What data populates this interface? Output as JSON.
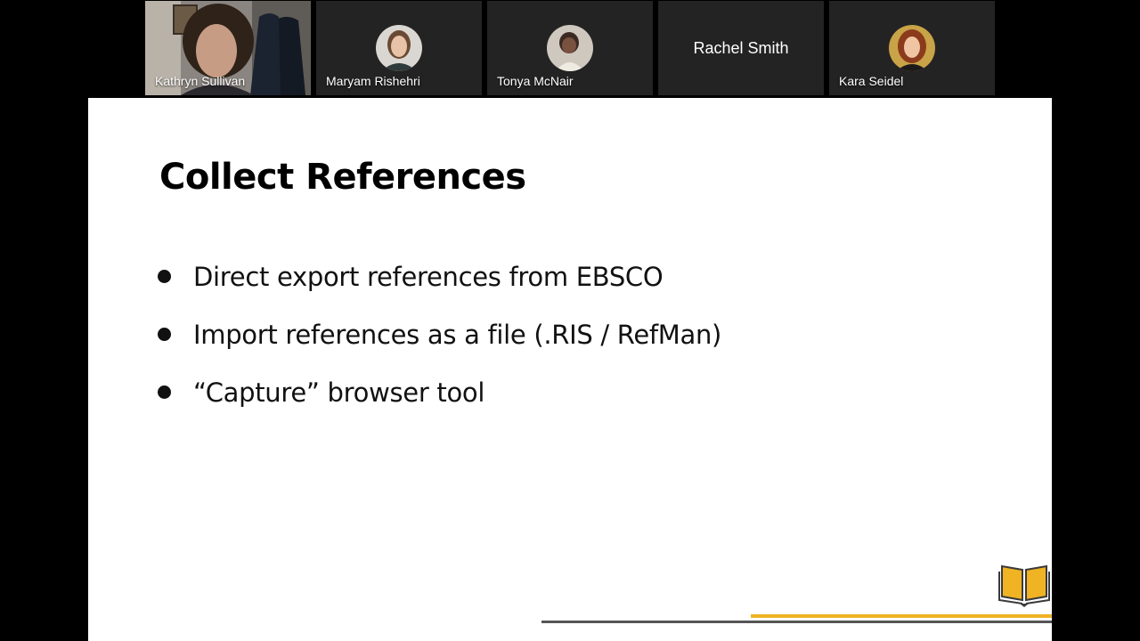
{
  "participants": [
    {
      "name": "Kathryn Sullivan"
    },
    {
      "name": "Maryam Rishehri"
    },
    {
      "name": "Tonya McNair"
    },
    {
      "name": "Rachel Smith"
    },
    {
      "name": "Kara Seidel"
    }
  ],
  "slide": {
    "title": "Collect References",
    "bullets": [
      "Direct export references from EBSCO",
      "Import references as a file (.RIS / RefMan)",
      "“Capture” browser tool"
    ]
  },
  "colors": {
    "accent_gold": "#f0b323",
    "rule_gray": "#555555",
    "tile_bg": "#232323"
  },
  "icons": {
    "slide_logo": "open-book-icon"
  }
}
